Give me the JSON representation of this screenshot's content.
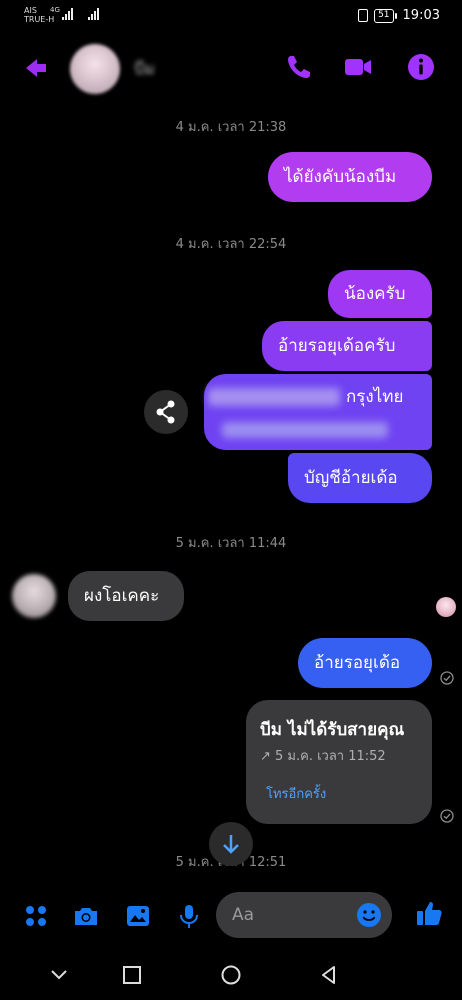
{
  "status_bar": {
    "carrier_line1": "AIS",
    "carrier_line2": "TRUE-H",
    "network": "4G",
    "battery": "51",
    "time": "19:03"
  },
  "header": {
    "contact_name": "บีม"
  },
  "messages": [
    {
      "type": "timestamp",
      "text": "4 ม.ค. เวลา 21:38"
    },
    {
      "type": "sent",
      "text": "ได้ยังคับน้องบีม"
    },
    {
      "type": "timestamp",
      "text": "4 ม.ค. เวลา 22:54"
    },
    {
      "type": "sent",
      "text": "น้องครับ"
    },
    {
      "type": "sent",
      "text": "อ้ายรอยุเด้อครับ"
    },
    {
      "type": "sent",
      "text": "กรุงไทย"
    },
    {
      "type": "sent",
      "text": "บัญชีอ้ายเด้อ"
    },
    {
      "type": "timestamp",
      "text": "5 ม.ค. เวลา 11:44"
    },
    {
      "type": "received",
      "text": "ผงโอเคคะ"
    },
    {
      "type": "sent",
      "text": "อ้ายรอยุเด้อ"
    },
    {
      "type": "timestamp",
      "text": "5 ม.ค. เวลา 12:51"
    }
  ],
  "missed_call": {
    "title": "บีม ไม่ได้รับสายคุณ",
    "time": "↗ 5 ม.ค. เวลา 11:52",
    "action": "โทรอีกครั้ง"
  },
  "composer": {
    "placeholder": "Aa"
  },
  "colors": {
    "accent": "#a033ff",
    "bubble_top": "#b23cf0",
    "bubble_bottom": "#2f5df0",
    "link": "#1877f2",
    "received_bubble": "#3a3a3c"
  }
}
